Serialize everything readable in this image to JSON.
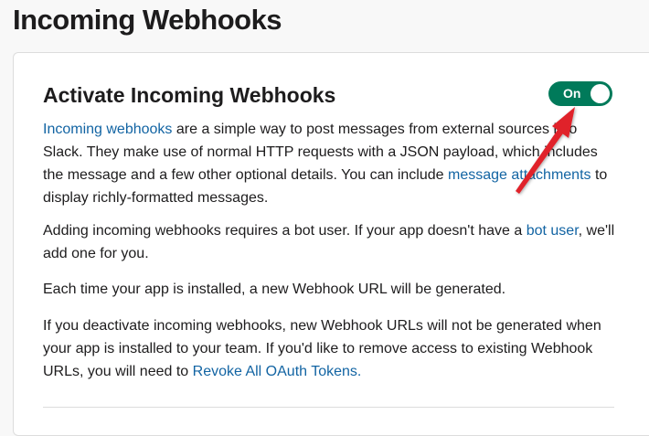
{
  "page": {
    "title": "Incoming Webhooks"
  },
  "section": {
    "title": "Activate Incoming Webhooks",
    "toggle": {
      "label": "On",
      "state": "on",
      "color": "#007a5a"
    }
  },
  "paragraphs": {
    "p1": {
      "link_incoming": "Incoming webhooks",
      "text_a": " are a simple way to post messages from external sources into Slack. They make use of normal HTTP requests with a JSON payload, which includes the message and a few other optional details. You can include ",
      "link_attachments": "message attachments",
      "text_b": " to display richly-formatted messages."
    },
    "p2": {
      "text_a": "Adding incoming webhooks requires a bot user. If your app doesn't have a ",
      "link_bot_user": "bot user",
      "text_b": ", we'll add one for you."
    },
    "p3": {
      "text": "Each time your app is installed, a new Webhook URL will be generated."
    },
    "p4": {
      "text_a": "If you deactivate incoming webhooks, new Webhook URLs will not be generated when your app is installed to your team. If you'd like to remove access to existing Webhook URLs, you will need to ",
      "link_revoke": "Revoke All OAuth Tokens.",
      "text_b": ""
    }
  },
  "colors": {
    "link": "#1264a3",
    "annotation_arrow": "#e0242b"
  },
  "icons": {
    "annotation": "red-arrow-icon"
  }
}
